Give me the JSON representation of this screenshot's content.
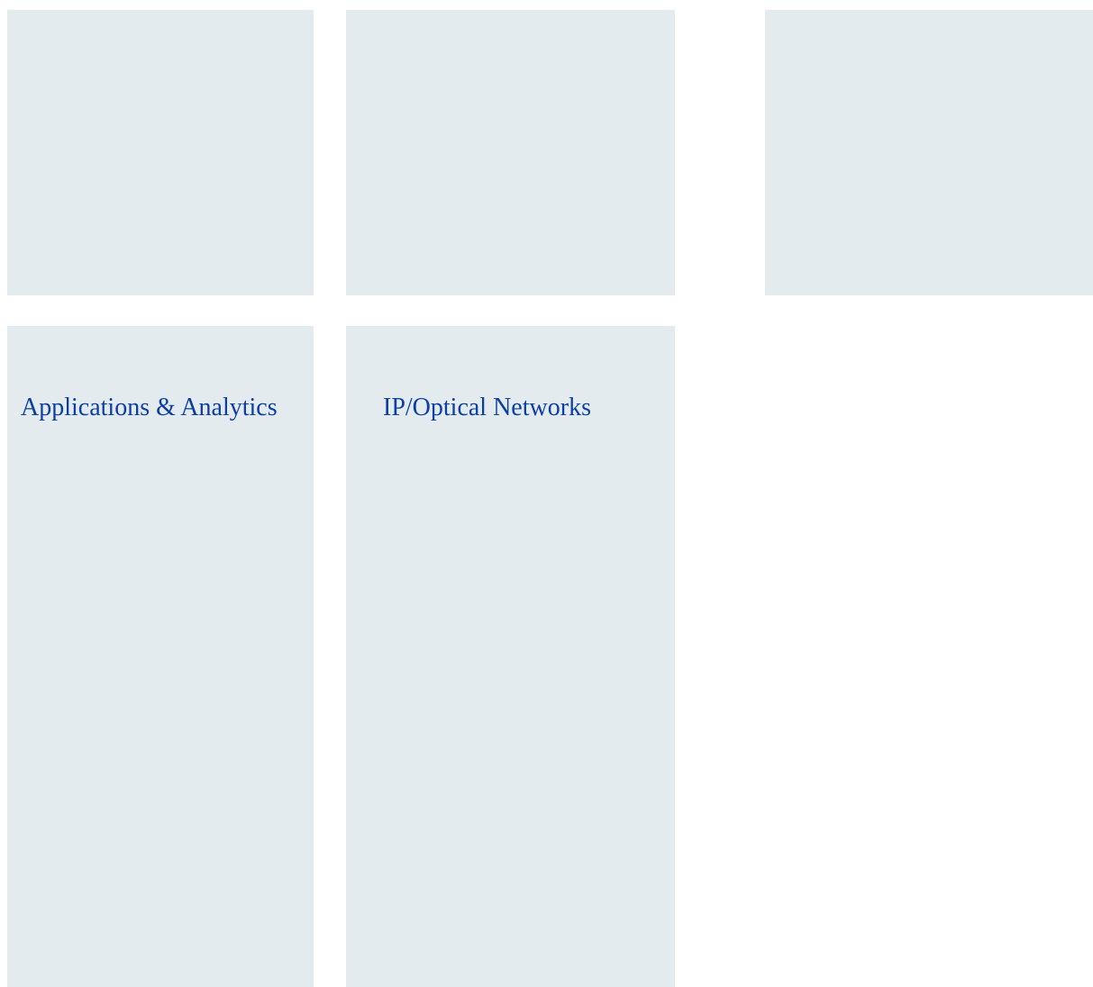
{
  "tiles": [
    {
      "title": ""
    },
    {
      "title": ""
    },
    {
      "title": ""
    },
    {
      "title": "Applications & Analytics"
    },
    {
      "title": "IP/Optical Networks"
    }
  ],
  "colors": {
    "tile_background": "#e4ebef",
    "link_text": "#0b3ea8",
    "page_background": "#ffffff"
  }
}
